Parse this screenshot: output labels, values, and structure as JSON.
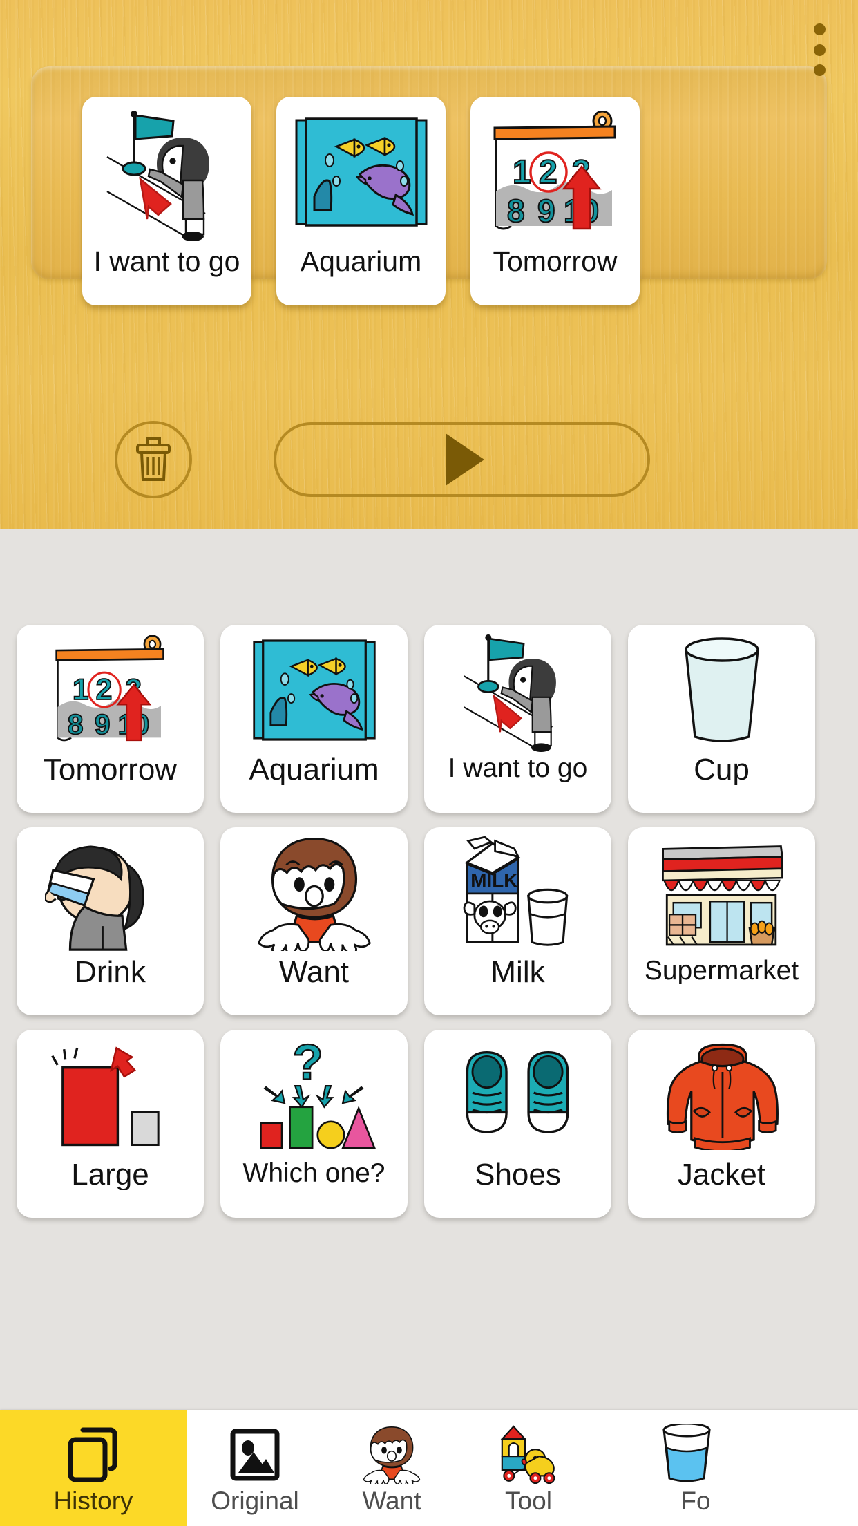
{
  "header": {
    "overflow_menu_icon": "more-vertical-icon",
    "sentence_cards": [
      {
        "label": "I want to go",
        "icon": "person-pointing-flag-icon"
      },
      {
        "label": "Aquarium",
        "icon": "aquarium-tank-icon"
      },
      {
        "label": "Tomorrow",
        "icon": "calendar-tomorrow-icon"
      }
    ],
    "delete_button": {
      "icon": "trash-icon",
      "label": ""
    },
    "play_button": {
      "icon": "play-icon",
      "label": ""
    }
  },
  "board": {
    "tiles": [
      {
        "label": "Tomorrow",
        "icon": "calendar-tomorrow-icon"
      },
      {
        "label": "Aquarium",
        "icon": "aquarium-tank-icon"
      },
      {
        "label": "I want to go",
        "icon": "person-pointing-flag-icon"
      },
      {
        "label": "Cup",
        "icon": "cup-icon"
      },
      {
        "label": "Drink",
        "icon": "person-drinking-icon"
      },
      {
        "label": "Want",
        "icon": "child-wanting-icon"
      },
      {
        "label": "Milk",
        "icon": "milk-carton-icon"
      },
      {
        "label": "Supermarket",
        "icon": "supermarket-storefront-icon"
      },
      {
        "label": "Large",
        "icon": "large-small-box-icon"
      },
      {
        "label": "Which one?",
        "icon": "question-shapes-icon"
      },
      {
        "label": "Shoes",
        "icon": "sneakers-icon"
      },
      {
        "label": "Jacket",
        "icon": "hoodie-jacket-icon"
      }
    ]
  },
  "bottom_nav": {
    "active_index": 0,
    "items": [
      {
        "label": "History",
        "icon": "cards-stack-icon"
      },
      {
        "label": "Original",
        "icon": "photo-image-icon"
      },
      {
        "label": "Want",
        "icon": "child-wanting-icon"
      },
      {
        "label": "Tool",
        "icon": "toy-blocks-duck-icon"
      },
      {
        "label": "Fo",
        "icon": "glass-water-icon"
      }
    ]
  },
  "colors": {
    "header_wood": "#eabe51",
    "tray_wood": "#e7bd57",
    "board_bg": "#e4e2df",
    "card_white": "#ffffff",
    "active_tab_yellow": "#fcd927",
    "accent_teal": "#1aa5ad",
    "accent_red": "#e0231f",
    "accent_orange": "#f37a21",
    "icon_brown": "#8a6508"
  }
}
